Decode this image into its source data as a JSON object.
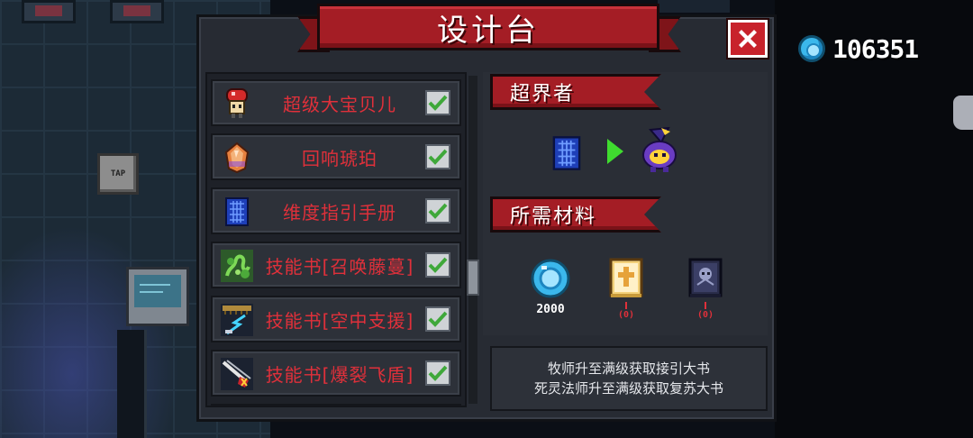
{
  "window": {
    "title": "设计台"
  },
  "currency": {
    "gems": "106351"
  },
  "recipes": [
    {
      "label": "超级大宝贝儿",
      "icon": "mushroom-buddy-icon",
      "checked": true
    },
    {
      "label": "回响琥珀",
      "icon": "amber-gem-icon",
      "checked": true
    },
    {
      "label": "维度指引手册",
      "icon": "blue-manual-icon",
      "checked": true
    },
    {
      "label": "技能书[召唤藤蔓]",
      "icon": "vine-skillbook-icon",
      "checked": true
    },
    {
      "label": "技能书[空中支援]",
      "icon": "air-support-skillbook-icon",
      "checked": true
    },
    {
      "label": "技能书[爆裂飞盾]",
      "icon": "shield-skillbook-icon",
      "checked": true
    }
  ],
  "detail": {
    "name": "超界者",
    "materials_title": "所需材料",
    "materials": [
      {
        "icon": "gem-material-icon",
        "quantity": "2000",
        "owned": ""
      },
      {
        "icon": "golden-book-icon",
        "quantity": "1",
        "owned": "(0)"
      },
      {
        "icon": "dark-book-icon",
        "quantity": "1",
        "owned": "(0)"
      }
    ],
    "hint_lines": [
      "牧师升至满级获取接引大书",
      "死灵法师升至满级获取复苏大书"
    ]
  },
  "background": {
    "tap_sign": "TAP"
  },
  "colors": {
    "accent_red": "#a41d25",
    "item_label": "#e0303a",
    "check_green": "#3fa83a",
    "gem_blue": "#3bb8ec"
  }
}
